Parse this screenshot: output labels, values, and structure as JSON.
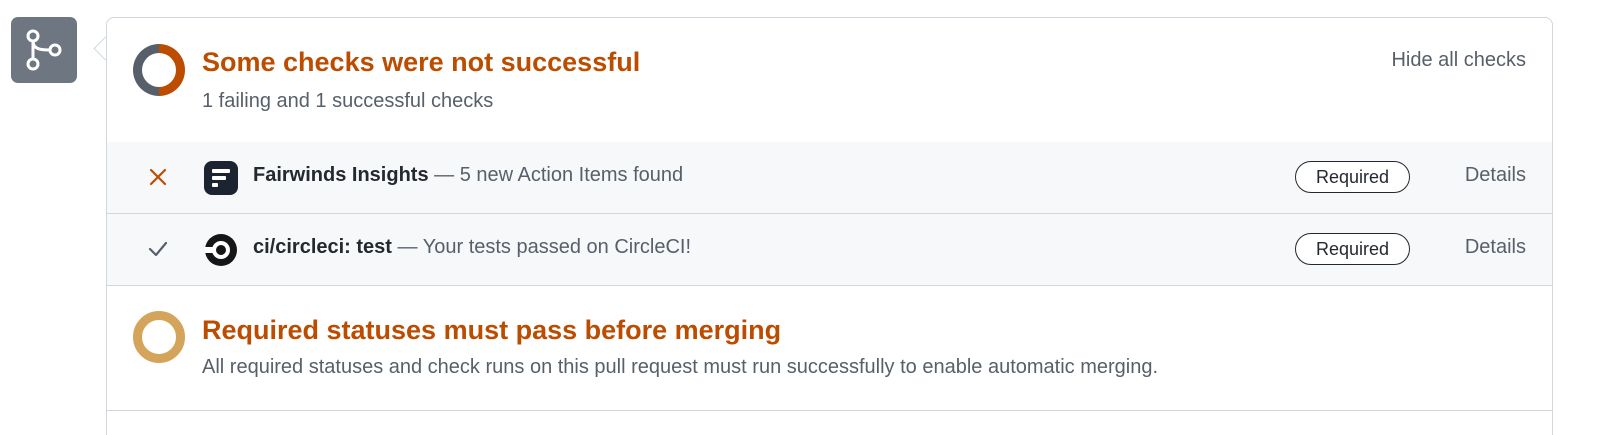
{
  "merge_box": {
    "icon": "git-merge-icon",
    "tile_color": "#6e7781"
  },
  "checks_summary": {
    "title": "Some checks were not successful",
    "subtitle": "1 failing and 1 successful checks",
    "hide_label": "Hide all checks",
    "icon": "status-donut-icon",
    "title_color": "#bc4c00"
  },
  "checks": [
    {
      "status": "failed",
      "status_icon": "x-icon",
      "logo": "fairwinds-logo-icon",
      "name": "Fairwinds Insights",
      "description": " — 5 new Action Items found",
      "badge": "Required",
      "details_label": "Details"
    },
    {
      "status": "passed",
      "status_icon": "check-icon",
      "logo": "circleci-logo-icon",
      "name": "ci/circleci: test",
      "description": " — Your tests passed on CircleCI!",
      "badge": "Required",
      "details_label": "Details"
    }
  ],
  "required_statuses": {
    "title": "Required statuses must pass before merging",
    "description": "All required statuses and check runs on this pull request must run successfully to enable automatic merging.",
    "icon": "pending-ring-icon",
    "ring_color": "#d4a45b"
  }
}
